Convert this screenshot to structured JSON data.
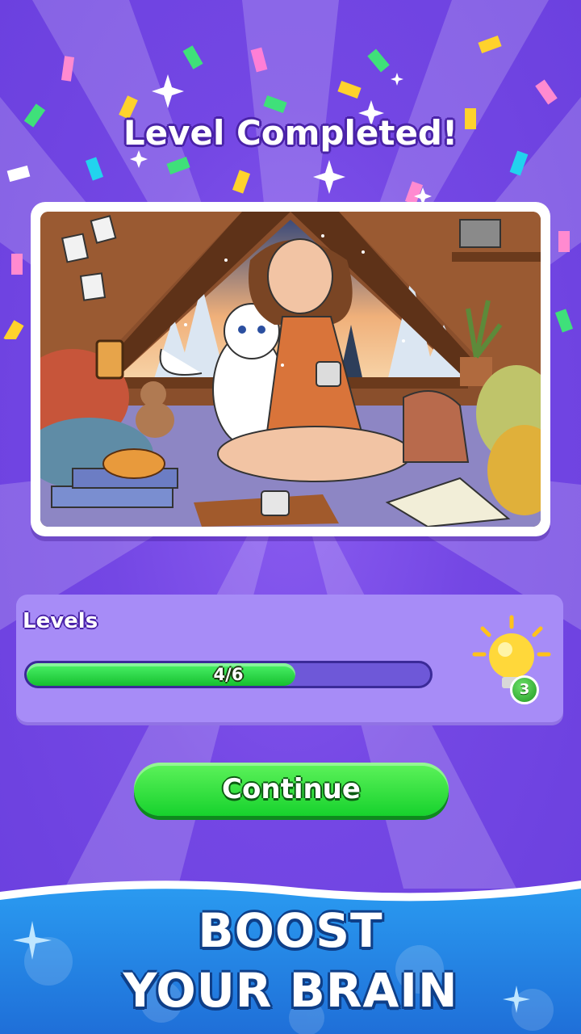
{
  "header": {
    "title": "Level Completed!"
  },
  "picture": {
    "description_icon": "cozy-attic-illustration"
  },
  "levels": {
    "label": "Levels",
    "progress_text": "4/6",
    "progress_fraction": 0.6667
  },
  "hint": {
    "icon": "lightbulb-icon",
    "count": "3"
  },
  "actions": {
    "continue_label": "Continue"
  },
  "banner": {
    "line1": "BOOST",
    "line2": "YOUR BRAIN"
  },
  "colors": {
    "background": "#7447e4",
    "button_green": "#17d22d",
    "panel": "#a78cf7",
    "banner_blue": "#1f86e8"
  }
}
